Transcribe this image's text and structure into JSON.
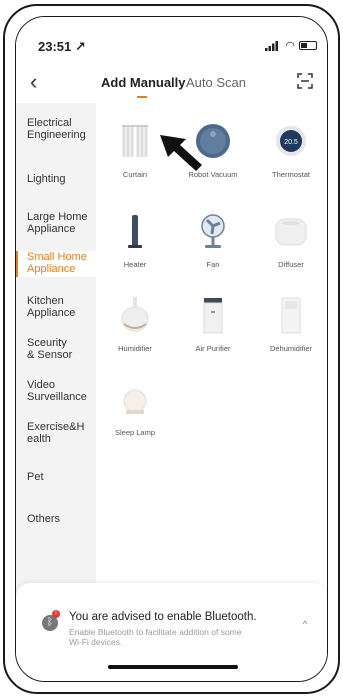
{
  "status": {
    "time": "23:51 ↗"
  },
  "nav": {
    "tab_active": "Add Manually",
    "tab_inactive": "Auto Scan",
    "accent": "#f07b1a"
  },
  "sidebar": {
    "items": [
      {
        "label": "Electrical\nEngineering"
      },
      {
        "label": "Lighting"
      },
      {
        "label": "Large Home\nAppliance"
      },
      {
        "label": "Small Home\nAppliance"
      },
      {
        "label": "Kitchen\nAppliance"
      },
      {
        "label": "Sceurity\n& Sensor"
      },
      {
        "label": "Video\nSurveillance"
      },
      {
        "label": "Exercise&H\nealth"
      },
      {
        "label": "Pet"
      },
      {
        "label": "Others"
      }
    ],
    "active_index": 3
  },
  "devices": [
    {
      "label": "Curtain",
      "icon": "curtain-icon"
    },
    {
      "label": "Robot Vacuum",
      "icon": "robot-vacuum-icon"
    },
    {
      "label": "Thermostat",
      "icon": "thermostat-icon",
      "display": "20.5"
    },
    {
      "label": "Heater",
      "icon": "heater-icon"
    },
    {
      "label": "Fan",
      "icon": "fan-icon"
    },
    {
      "label": "Diffuser",
      "icon": "diffuser-icon"
    },
    {
      "label": "Humidifier",
      "icon": "humidifier-icon"
    },
    {
      "label": "Air Purifier",
      "icon": "air-purifier-icon"
    },
    {
      "label": "Dehumidifier",
      "icon": "dehumidifier-icon"
    },
    {
      "label": "Sleep Lamp",
      "icon": "sleep-lamp-icon"
    }
  ],
  "bluetooth": {
    "title": "You are advised to enable Bluetooth.",
    "desc": "Enable Bluetooth to facilitate addition of some Wi-Fi devices."
  }
}
